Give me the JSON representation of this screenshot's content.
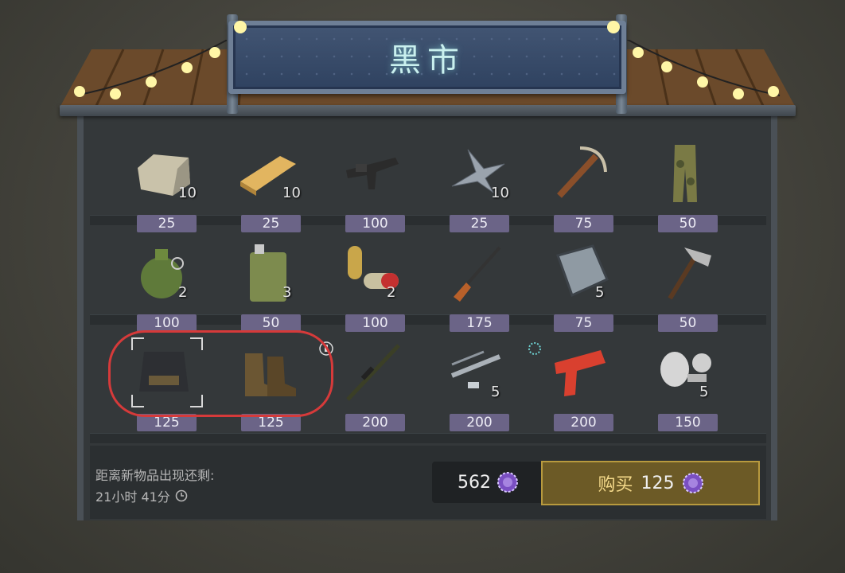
{
  "sign": {
    "title": "黑市"
  },
  "items": [
    {
      "name": "stone",
      "qty": "10",
      "price": "25"
    },
    {
      "name": "plank",
      "qty": "10",
      "price": "25"
    },
    {
      "name": "uzi",
      "qty": "",
      "price": "100"
    },
    {
      "name": "metal-scrap",
      "qty": "10",
      "price": "25"
    },
    {
      "name": "crossbow",
      "qty": "",
      "price": "75"
    },
    {
      "name": "camo-pants",
      "qty": "",
      "price": "50"
    },
    {
      "name": "grenade",
      "qty": "2",
      "price": "100"
    },
    {
      "name": "jerrycan",
      "qty": "3",
      "price": "50"
    },
    {
      "name": "pills",
      "qty": "2",
      "price": "100"
    },
    {
      "name": "shotgun",
      "qty": "",
      "price": "175"
    },
    {
      "name": "metal-sheet",
      "qty": "5",
      "price": "75"
    },
    {
      "name": "pickaxe",
      "qty": "",
      "price": "50"
    },
    {
      "name": "tactical-vest",
      "qty": "",
      "price": "125"
    },
    {
      "name": "boots",
      "qty": "",
      "price": "125"
    },
    {
      "name": "sniper-rifle",
      "qty": "",
      "price": "200"
    },
    {
      "name": "pipes",
      "qty": "5",
      "price": "200"
    },
    {
      "name": "flare-gun",
      "qty": "",
      "price": "200"
    },
    {
      "name": "gas-mask-parts",
      "qty": "5",
      "price": "150"
    }
  ],
  "footer": {
    "timer_label": "距离新物品出现还剩:",
    "timer_value": "21小时 41分",
    "balance": "562",
    "buy_label": "购买",
    "buy_price": "125"
  },
  "colors": {
    "price_bg": "#6b6487",
    "buy_bg": "#6c5a26",
    "sign_text": "#c9f0ee",
    "highlight": "#d63a3a"
  }
}
